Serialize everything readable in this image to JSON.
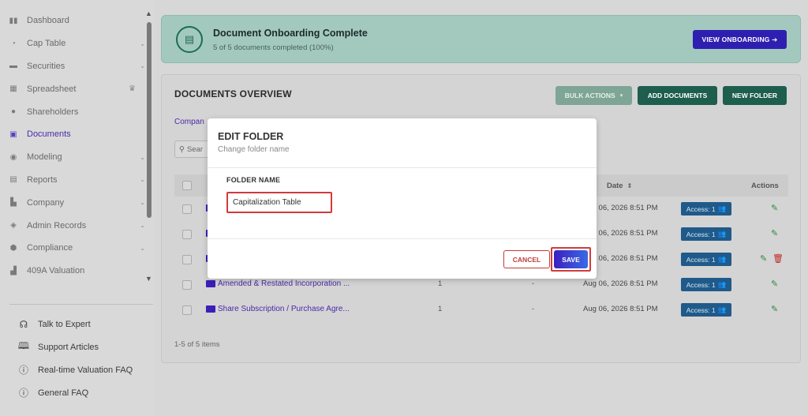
{
  "sidebar": {
    "items": [
      {
        "label": "Dashboard",
        "icon": "dashboard-icon",
        "chevron": false
      },
      {
        "label": "Cap Table",
        "icon": "pie-chart-icon",
        "chevron": true
      },
      {
        "label": "Securities",
        "icon": "securities-icon",
        "chevron": true
      },
      {
        "label": "Spreadsheet",
        "icon": "spreadsheet-icon",
        "chevron": false,
        "badge": "crown-icon"
      },
      {
        "label": "Shareholders",
        "icon": "person-icon",
        "chevron": false
      },
      {
        "label": "Documents",
        "icon": "document-icon",
        "chevron": false,
        "active": true
      },
      {
        "label": "Modeling",
        "icon": "lightbulb-icon",
        "chevron": true
      },
      {
        "label": "Reports",
        "icon": "report-icon",
        "chevron": true
      },
      {
        "label": "Company",
        "icon": "building-icon",
        "chevron": true
      },
      {
        "label": "Admin Records",
        "icon": "admin-icon",
        "chevron": true
      },
      {
        "label": "Compliance",
        "icon": "shield-icon",
        "chevron": true
      },
      {
        "label": "409A Valuation",
        "icon": "valuation-icon",
        "chevron": false
      }
    ],
    "help": [
      {
        "label": "Talk to Expert",
        "icon": "headset-icon"
      },
      {
        "label": "Support Articles",
        "icon": "book-icon"
      },
      {
        "label": "Real-time Valuation FAQ",
        "icon": "question-icon"
      },
      {
        "label": "General FAQ",
        "icon": "question-icon"
      }
    ]
  },
  "banner": {
    "title": "Document Onboarding Complete",
    "subtitle": "5 of 5 documents completed (100%)",
    "button": "VIEW ONBOARDING ➔"
  },
  "overview": {
    "title": "DOCUMENTS OVERVIEW",
    "bulk_actions": "BULK ACTIONS",
    "add_documents": "ADD DOCUMENTS",
    "new_folder": "NEW FOLDER",
    "tab": "Compan",
    "search_placeholder": "Sear",
    "columns": {
      "date": "Date",
      "actions": "Actions"
    },
    "rows": [
      {
        "name": "",
        "count": "",
        "dash": "",
        "date": "Aug 06, 2026 8:51 PM",
        "access": "Access: 1"
      },
      {
        "name": "",
        "count": "",
        "dash": "",
        "date": "Aug 06, 2026 8:51 PM",
        "access": "Access: 1"
      },
      {
        "name": "",
        "count": "",
        "dash": "",
        "date": "Aug 06, 2026 8:51 PM",
        "access": "Access: 1",
        "delete": true
      },
      {
        "name": "Amended & Restated Incorporation ...",
        "count": "1",
        "dash": "-",
        "date": "Aug 06, 2026 8:51 PM",
        "access": "Access: 1"
      },
      {
        "name": "Share Subscription / Purchase Agre...",
        "count": "1",
        "dash": "-",
        "date": "Aug 06, 2026 8:51 PM",
        "access": "Access: 1"
      }
    ],
    "footer": "1-5 of 5 items"
  },
  "modal": {
    "title": "EDIT FOLDER",
    "subtitle": "Change folder name",
    "field_label": "FOLDER NAME",
    "field_value": "Capitalization Table",
    "cancel": "CANCEL",
    "save": "SAVE"
  },
  "colors": {
    "accent": "#4b2aa8",
    "primary_green": "#1d5e4e",
    "banner_bg": "#a3c9bf",
    "highlight_red": "#d23a3a"
  }
}
